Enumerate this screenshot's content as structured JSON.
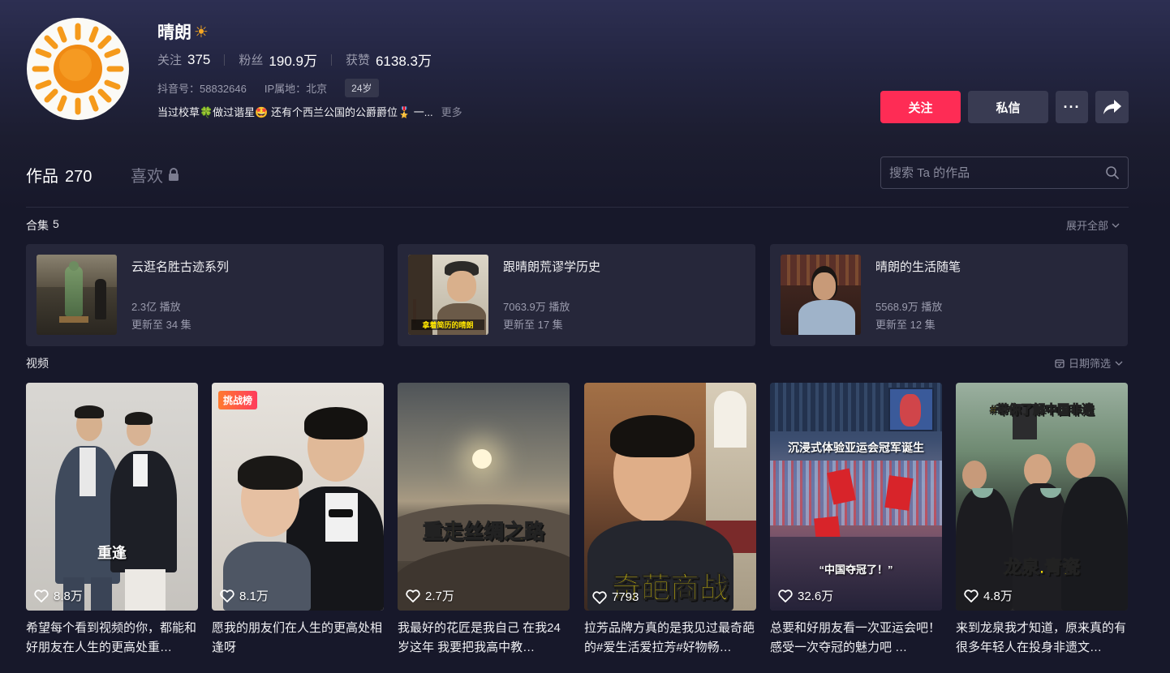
{
  "profile": {
    "name": "晴朗",
    "name_emoji": "☀",
    "stats": [
      {
        "label": "关注",
        "value": "375"
      },
      {
        "label": "粉丝",
        "value": "190.9万"
      },
      {
        "label": "获赞",
        "value": "6138.3万"
      }
    ],
    "douyin_id": "抖音号：58832646",
    "ip_location": "IP属地：北京",
    "age": "24岁",
    "bio": "当过校草🍀做过谐星🤩 还有个西兰公国的公爵爵位🎖️ 一...",
    "bio_more": "更多"
  },
  "actions": {
    "follow": "关注",
    "message": "私信",
    "more": "···"
  },
  "tabs": {
    "works_label": "作品",
    "works_count": "270",
    "likes_label": "喜欢"
  },
  "search": {
    "placeholder": "搜索 Ta 的作品"
  },
  "collections": {
    "label": "合集",
    "count": "5",
    "expand_all": "展开全部",
    "items": [
      {
        "title": "云逛名胜古迹系列",
        "plays": "2.3亿 播放",
        "updates": "更新至 34 集"
      },
      {
        "title": "跟晴朗荒谬学历史",
        "plays": "7063.9万 播放",
        "updates": "更新至 17 集",
        "thumb_caption": "拿着简历的晴朗"
      },
      {
        "title": "晴朗的生活随笔",
        "plays": "5568.9万 播放",
        "updates": "更新至 12 集"
      }
    ]
  },
  "videos": {
    "label": "视频",
    "date_filter": "日期筛选",
    "items": [
      {
        "likes": "8.8万",
        "overlay": "重逢",
        "caption": "希望每个看到视频的你，都能和好朋友在人生的更高处重…"
      },
      {
        "likes": "8.1万",
        "badge": "挑战榜",
        "caption": "愿我的朋友们在人生的更高处相逢呀"
      },
      {
        "likes": "2.7万",
        "overlay": "重走丝绸之路",
        "caption": "我最好的花匠是我自己 在我24岁这年 我要把我高中教…"
      },
      {
        "likes": "7793",
        "overlay": "奇葩商战",
        "caption": "拉芳品牌方真的是我见过最奇葩的#爱生活爱拉芳#好物畅…"
      },
      {
        "likes": "32.6万",
        "overlay_top": "沉浸式体验亚运会冠军诞生",
        "overlay_bottom": "“中国夺冠了！”",
        "caption": "总要和好朋友看一次亚运会吧！感受一次夺冠的魅力吧 …"
      },
      {
        "likes": "4.8万",
        "overlay_top": "#带你了解中国非遗",
        "overlay": "龙泉.青瓷",
        "caption": "来到龙泉我才知道，原来真的有很多年轻人在投身非遗文…"
      }
    ]
  },
  "colors": {
    "accent": "#fe2c55",
    "button_secondary": "#393b52",
    "card": "#26273a",
    "overlay_yellow": "#ffe600"
  }
}
